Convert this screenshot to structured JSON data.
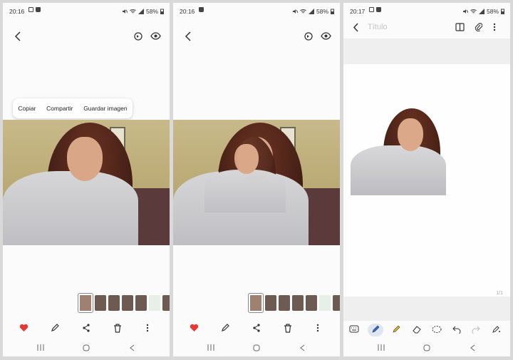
{
  "screens": [
    {
      "status": {
        "time": "20:16",
        "battery": "58%"
      },
      "context_menu": {
        "copy": "Copiar",
        "share": "Compartir",
        "save": "Guardar imagen"
      }
    },
    {
      "status": {
        "time": "20:16",
        "battery": "58%"
      }
    },
    {
      "status": {
        "time": "20:17",
        "battery": "58%"
      },
      "note": {
        "title_placeholder": "Título",
        "page_indicator": "1/1"
      }
    }
  ],
  "colors": {
    "heart": "#e53935",
    "pen_accent": "#2f6fd6",
    "highlighter": "#e6b422"
  },
  "icons": {
    "back": "chevron-left-icon",
    "rotate": "rotate-icon",
    "eye": "eye-icon",
    "favorite": "heart-icon",
    "edit": "pencil-icon",
    "share": "share-icon",
    "delete": "trash-icon",
    "more": "more-vertical-icon",
    "book": "book-icon",
    "attach": "paperclip-icon",
    "keyboard": "keyboard-icon",
    "pen": "pen-icon",
    "highlighter": "highlighter-icon",
    "eraser": "eraser-icon",
    "lasso": "lasso-icon",
    "undo": "undo-icon",
    "redo": "redo-icon",
    "style": "pen-settings-icon"
  }
}
